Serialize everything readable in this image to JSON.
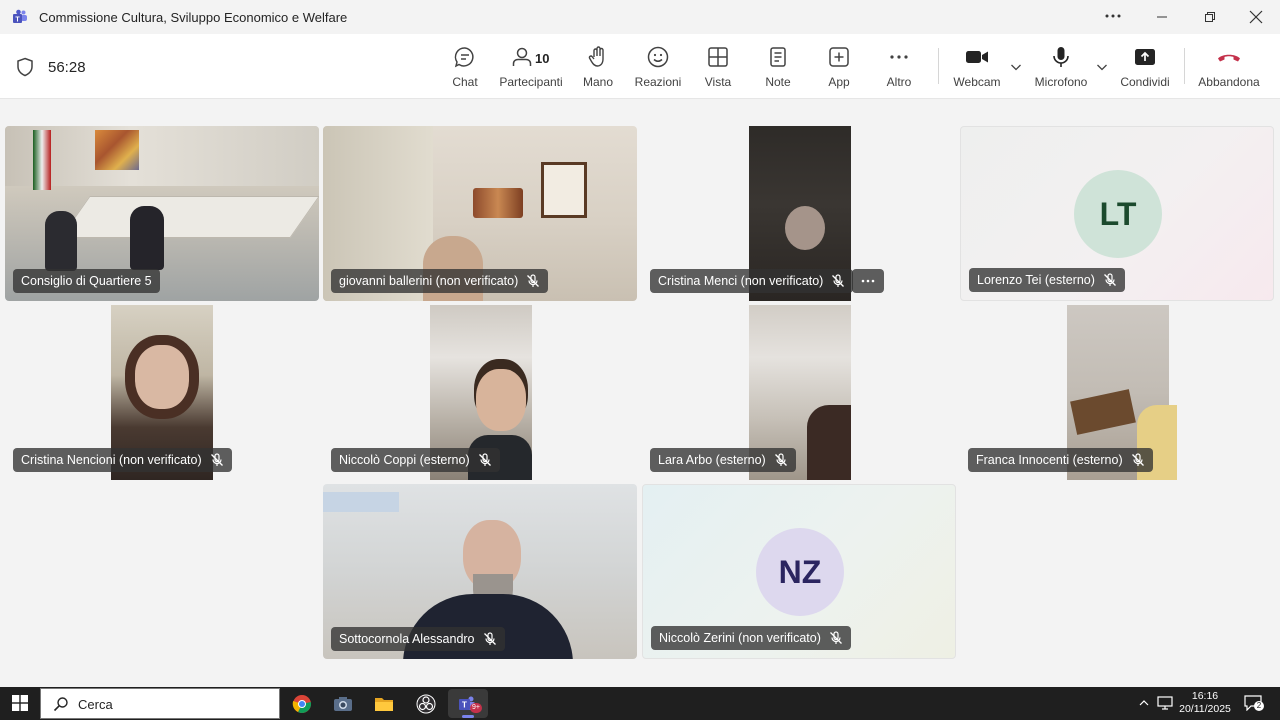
{
  "window": {
    "title": "Commissione Cultura, Sviluppo Economico e Welfare"
  },
  "meeting": {
    "timer": "56:28",
    "participants_count": "10",
    "tools": [
      {
        "label": "Chat",
        "icon": "chat-icon"
      },
      {
        "label": "Partecipanti",
        "icon": "people-icon"
      },
      {
        "label": "Mano",
        "icon": "raise-hand-icon"
      },
      {
        "label": "Reazioni",
        "icon": "smiley-icon"
      },
      {
        "label": "Vista",
        "icon": "grid-view-icon"
      },
      {
        "label": "Note",
        "icon": "notes-icon"
      },
      {
        "label": "App",
        "icon": "add-app-icon"
      },
      {
        "label": "Altro",
        "icon": "more-icon"
      },
      {
        "label": "Webcam",
        "icon": "camera-icon"
      },
      {
        "label": "Microfono",
        "icon": "microphone-icon"
      },
      {
        "label": "Condividi",
        "icon": "share-icon"
      },
      {
        "label": "Abbandona",
        "icon": "hang-up-icon"
      }
    ]
  },
  "participants": [
    {
      "name": "Consiglio di Quartiere 5",
      "muted": false,
      "type": "video"
    },
    {
      "name": "giovanni ballerini (non verificato)",
      "muted": true,
      "type": "video"
    },
    {
      "name": "Cristina Menci (non verificato)",
      "muted": true,
      "type": "video"
    },
    {
      "name": "Lorenzo Tei (esterno)",
      "muted": true,
      "type": "avatar",
      "initials": "LT"
    },
    {
      "name": "Cristina Nencioni (non verificato)",
      "muted": true,
      "type": "video"
    },
    {
      "name": "Niccolò Coppi (esterno)",
      "muted": true,
      "type": "video"
    },
    {
      "name": "Lara Arbo (esterno)",
      "muted": true,
      "type": "video"
    },
    {
      "name": "Franca Innocenti (esterno)",
      "muted": true,
      "type": "video"
    },
    {
      "name": "Sottocornola Alessandro",
      "muted": true,
      "type": "video"
    },
    {
      "name": "Niccolò Zerini (non verificato)",
      "muted": true,
      "type": "avatar",
      "initials": "NZ"
    }
  ],
  "taskbar": {
    "search_label": "Cerca",
    "teams_badge": "9+",
    "time": "16:16",
    "date": "20/11/2025",
    "notification_count": "2"
  },
  "colors": {
    "accent": "#5b5fc7",
    "hangup": "#c4314b",
    "lt_avatar_bg": "#cfe3d8",
    "lt_avatar_text": "#1b4a2d",
    "nz_avatar_bg": "#ddd8ee",
    "nz_avatar_text": "#2b2560"
  }
}
